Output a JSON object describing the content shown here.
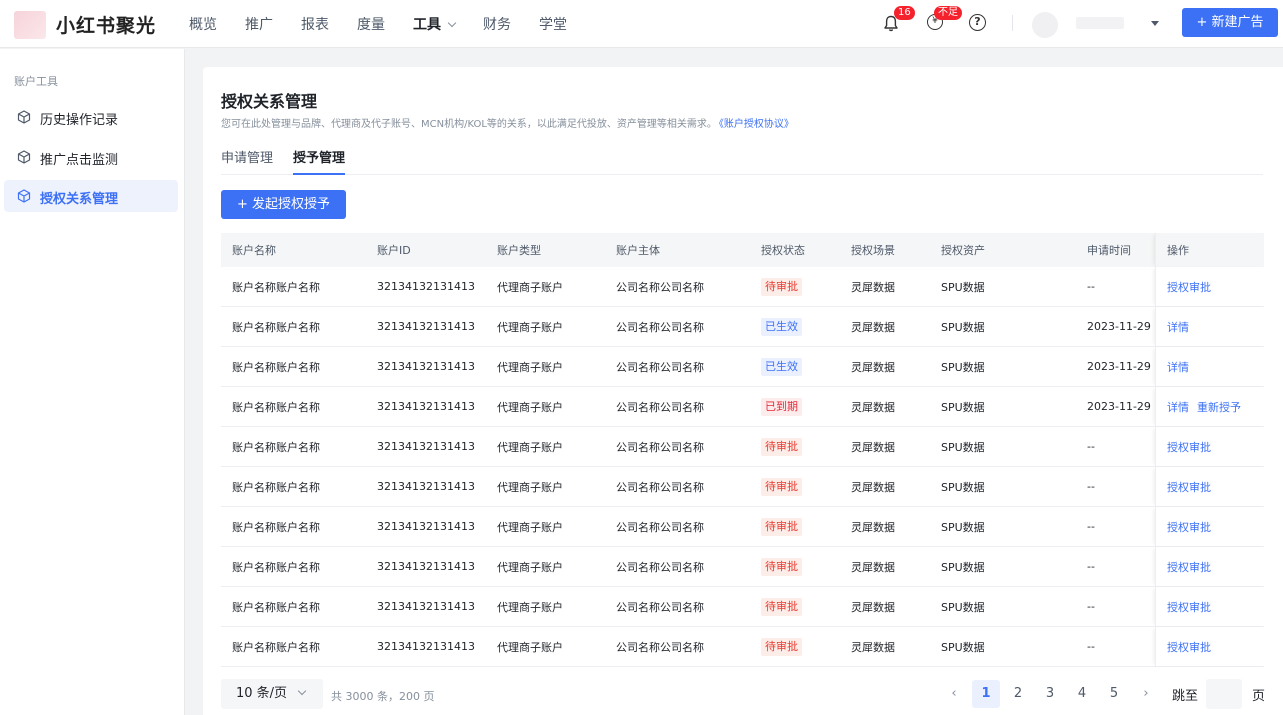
{
  "header": {
    "brand": "小红书聚光",
    "nav": [
      {
        "label": "概览"
      },
      {
        "label": "推广"
      },
      {
        "label": "报表"
      },
      {
        "label": "度量"
      },
      {
        "label": "工具"
      },
      {
        "label": "财务"
      },
      {
        "label": "学堂"
      }
    ],
    "notification_count": "16",
    "balance_badge": "不足",
    "balance_icon": "¥",
    "help_icon": "?",
    "new_ad_label": "+ 新建广告"
  },
  "sidebar": {
    "section_title": "账户工具",
    "items": [
      {
        "label": "历史操作记录"
      },
      {
        "label": "推广点击监测"
      },
      {
        "label": "授权关系管理"
      }
    ]
  },
  "main": {
    "title": "授权关系管理",
    "description": "您可在此处管理与品牌、代理商及代子账号、MCN机构/KOL等的关系，以此满足代投放、资产管理等相关需求。",
    "agreement_link": "《账户授权协议》",
    "tabs": [
      {
        "label": "申请管理"
      },
      {
        "label": "授予管理"
      }
    ],
    "primary_button": "+ 发起授权授予",
    "table": {
      "columns": [
        "账户名称",
        "账户ID",
        "账户类型",
        "账户主体",
        "授权状态",
        "授权场景",
        "授权资产",
        "申请时间",
        "操作"
      ],
      "rows": [
        {
          "name": "账户名称账户名称",
          "id": "32134132131413",
          "type": "代理商子账户",
          "subject": "公司名称公司名称",
          "status": "待审批",
          "scene": "灵犀数据",
          "asset": "SPU数据",
          "time": "--",
          "action1": "授权审批",
          "action2": ""
        },
        {
          "name": "账户名称账户名称",
          "id": "32134132131413",
          "type": "代理商子账户",
          "subject": "公司名称公司名称",
          "status": "已生效",
          "scene": "灵犀数据",
          "asset": "SPU数据",
          "time": "2023-11-29",
          "action1": "详情",
          "action2": ""
        },
        {
          "name": "账户名称账户名称",
          "id": "32134132131413",
          "type": "代理商子账户",
          "subject": "公司名称公司名称",
          "status": "已生效",
          "scene": "灵犀数据",
          "asset": "SPU数据",
          "time": "2023-11-29",
          "action1": "详情",
          "action2": ""
        },
        {
          "name": "账户名称账户名称",
          "id": "32134132131413",
          "type": "代理商子账户",
          "subject": "公司名称公司名称",
          "status": "已到期",
          "scene": "灵犀数据",
          "asset": "SPU数据",
          "time": "2023-11-29",
          "action1": "详情",
          "action2": "重新授予"
        },
        {
          "name": "账户名称账户名称",
          "id": "32134132131413",
          "type": "代理商子账户",
          "subject": "公司名称公司名称",
          "status": "待审批",
          "scene": "灵犀数据",
          "asset": "SPU数据",
          "time": "--",
          "action1": "授权审批",
          "action2": ""
        },
        {
          "name": "账户名称账户名称",
          "id": "32134132131413",
          "type": "代理商子账户",
          "subject": "公司名称公司名称",
          "status": "待审批",
          "scene": "灵犀数据",
          "asset": "SPU数据",
          "time": "--",
          "action1": "授权审批",
          "action2": ""
        },
        {
          "name": "账户名称账户名称",
          "id": "32134132131413",
          "type": "代理商子账户",
          "subject": "公司名称公司名称",
          "status": "待审批",
          "scene": "灵犀数据",
          "asset": "SPU数据",
          "time": "--",
          "action1": "授权审批",
          "action2": ""
        },
        {
          "name": "账户名称账户名称",
          "id": "32134132131413",
          "type": "代理商子账户",
          "subject": "公司名称公司名称",
          "status": "待审批",
          "scene": "灵犀数据",
          "asset": "SPU数据",
          "time": "--",
          "action1": "授权审批",
          "action2": ""
        },
        {
          "name": "账户名称账户名称",
          "id": "32134132131413",
          "type": "代理商子账户",
          "subject": "公司名称公司名称",
          "status": "待审批",
          "scene": "灵犀数据",
          "asset": "SPU数据",
          "time": "--",
          "action1": "授权审批",
          "action2": ""
        },
        {
          "name": "账户名称账户名称",
          "id": "32134132131413",
          "type": "代理商子账户",
          "subject": "公司名称公司名称",
          "status": "待审批",
          "scene": "灵犀数据",
          "asset": "SPU数据",
          "time": "--",
          "action1": "授权审批",
          "action2": ""
        }
      ]
    },
    "pagination": {
      "page_size": "10 条/页",
      "total": "共 3000 条，200 页",
      "pages": [
        "1",
        "2",
        "3",
        "4",
        "5"
      ],
      "current": "1",
      "prev_icon": "‹",
      "next_icon": "›",
      "jump_label": "跳至",
      "jump_value": "",
      "jump_unit": "页"
    }
  },
  "colors": {
    "accent": "#3c70f5",
    "pending": "#e83a2f",
    "active": "#3c70f5",
    "expired": "#e32a3a"
  }
}
